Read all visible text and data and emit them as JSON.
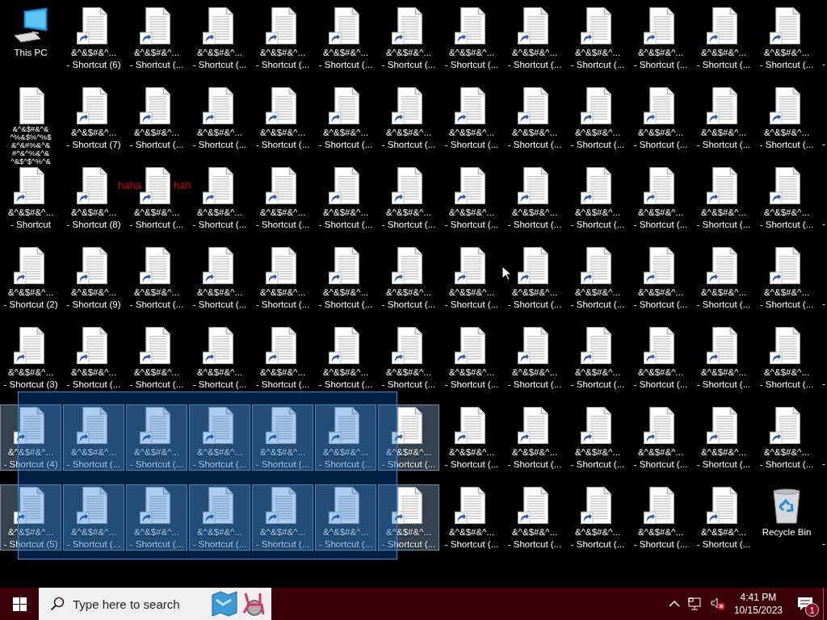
{
  "desktop": {
    "rows": [
      [
        {
          "kind": "pc",
          "label": [
            "This PC"
          ],
          "selected": false
        },
        {
          "kind": "shortcut",
          "label": [
            "&^&$#&^...",
            "- Shortcut (6)"
          ],
          "selected": false
        },
        {
          "kind": "shortcut",
          "label": [
            "&^&$#&^...",
            "- Shortcut (..."
          ],
          "selected": false
        },
        {
          "kind": "shortcut",
          "label": [
            "&^&$#&^...",
            "- Shortcut (..."
          ],
          "selected": false
        },
        {
          "kind": "shortcut",
          "label": [
            "&^&$#&^...",
            "- Shortcut (..."
          ],
          "selected": false
        },
        {
          "kind": "shortcut",
          "label": [
            "&^&$#&^...",
            "- Shortcut (..."
          ],
          "selected": false
        },
        {
          "kind": "shortcut",
          "label": [
            "&^&$#&^...",
            "- Shortcut (..."
          ],
          "selected": false
        },
        {
          "kind": "shortcut",
          "label": [
            "&^&$#&^...",
            "- Shortcut (..."
          ],
          "selected": false
        },
        {
          "kind": "shortcut",
          "label": [
            "&^&$#&^...",
            "- Shortcut (..."
          ],
          "selected": false
        },
        {
          "kind": "shortcut",
          "label": [
            "&^&$#&^...",
            "- Shortcut (..."
          ],
          "selected": false
        },
        {
          "kind": "shortcut",
          "label": [
            "&^&$#&^...",
            "- Shortcut (..."
          ],
          "selected": false
        },
        {
          "kind": "shortcut",
          "label": [
            "&^&$#&^...",
            "- Shortcut (..."
          ],
          "selected": false
        },
        {
          "kind": "shortcut",
          "label": [
            "&^&$#&^...",
            "- Shortcut (..."
          ],
          "selected": false
        },
        {
          "kind": "edge",
          "label": [
            "-"
          ],
          "selected": false
        }
      ],
      [
        {
          "kind": "file",
          "label": [
            "&^&$#&^&",
            "^%&$%^%$",
            "&^&#%&^&",
            "#^&^%&^&",
            "^&$^$^%^&"
          ],
          "selected": false
        },
        {
          "kind": "shortcut",
          "label": [
            "&^&$#&^...",
            "- Shortcut (7)"
          ],
          "selected": false
        },
        {
          "kind": "shortcut",
          "label": [
            "&^&$#&^...",
            "- Shortcut (..."
          ],
          "selected": false
        },
        {
          "kind": "shortcut",
          "label": [
            "&^&$#&^...",
            "- Shortcut (..."
          ],
          "selected": false
        },
        {
          "kind": "shortcut",
          "label": [
            "&^&$#&^...",
            "- Shortcut (..."
          ],
          "selected": false
        },
        {
          "kind": "shortcut",
          "label": [
            "&^&$#&^...",
            "- Shortcut (..."
          ],
          "selected": false
        },
        {
          "kind": "shortcut",
          "label": [
            "&^&$#&^...",
            "- Shortcut (..."
          ],
          "selected": false
        },
        {
          "kind": "shortcut",
          "label": [
            "&^&$#&^...",
            "- Shortcut (..."
          ],
          "selected": false
        },
        {
          "kind": "shortcut",
          "label": [
            "&^&$#&^...",
            "- Shortcut (..."
          ],
          "selected": false
        },
        {
          "kind": "shortcut",
          "label": [
            "&^&$#&^...",
            "- Shortcut (..."
          ],
          "selected": false
        },
        {
          "kind": "shortcut",
          "label": [
            "&^&$#&^...",
            "- Shortcut (..."
          ],
          "selected": false
        },
        {
          "kind": "shortcut",
          "label": [
            "&^&$#&^...",
            "- Shortcut (..."
          ],
          "selected": false
        },
        {
          "kind": "shortcut",
          "label": [
            "&^&$#&^...",
            "- Shortcut (..."
          ],
          "selected": false
        },
        {
          "kind": "edge",
          "label": [
            "-"
          ],
          "selected": false
        }
      ],
      [
        {
          "kind": "shortcut",
          "label": [
            "&^&$#&^...",
            "- Shortcut"
          ],
          "selected": false
        },
        {
          "kind": "shortcut",
          "label": [
            "&^&$#&^...",
            "- Shortcut (8)"
          ],
          "selected": false
        },
        {
          "kind": "shortcut",
          "label": [
            "&^&$#&^...",
            "- Shortcut (..."
          ],
          "selected": false
        },
        {
          "kind": "shortcut",
          "label": [
            "&^&$#&^...",
            "- Shortcut (..."
          ],
          "selected": false
        },
        {
          "kind": "shortcut",
          "label": [
            "&^&$#&^...",
            "- Shortcut (..."
          ],
          "selected": false
        },
        {
          "kind": "shortcut",
          "label": [
            "&^&$#&^...",
            "- Shortcut (..."
          ],
          "selected": false
        },
        {
          "kind": "shortcut",
          "label": [
            "&^&$#&^...",
            "- Shortcut (..."
          ],
          "selected": false
        },
        {
          "kind": "shortcut",
          "label": [
            "&^&$#&^...",
            "- Shortcut (..."
          ],
          "selected": false
        },
        {
          "kind": "shortcut",
          "label": [
            "&^&$#&^...",
            "- Shortcut (..."
          ],
          "selected": false
        },
        {
          "kind": "shortcut",
          "label": [
            "&^&$#&^...",
            "- Shortcut (..."
          ],
          "selected": false
        },
        {
          "kind": "shortcut",
          "label": [
            "&^&$#&^...",
            "- Shortcut (..."
          ],
          "selected": false
        },
        {
          "kind": "shortcut",
          "label": [
            "&^&$#&^...",
            "- Shortcut (..."
          ],
          "selected": false
        },
        {
          "kind": "shortcut",
          "label": [
            "&^&$#&^...",
            "- Shortcut (..."
          ],
          "selected": false
        },
        {
          "kind": "edge",
          "label": [
            "-"
          ],
          "selected": false
        }
      ],
      [
        {
          "kind": "shortcut",
          "label": [
            "&^&$#&^...",
            "- Shortcut (2)"
          ],
          "selected": false
        },
        {
          "kind": "shortcut",
          "label": [
            "&^&$#&^...",
            "- Shortcut (9)"
          ],
          "selected": false
        },
        {
          "kind": "shortcut",
          "label": [
            "&^&$#&^...",
            "- Shortcut (..."
          ],
          "selected": false
        },
        {
          "kind": "shortcut",
          "label": [
            "&^&$#&^...",
            "- Shortcut (..."
          ],
          "selected": false
        },
        {
          "kind": "shortcut",
          "label": [
            "&^&$#&^...",
            "- Shortcut (..."
          ],
          "selected": false
        },
        {
          "kind": "shortcut",
          "label": [
            "&^&$#&^...",
            "- Shortcut (..."
          ],
          "selected": false
        },
        {
          "kind": "shortcut",
          "label": [
            "&^&$#&^...",
            "- Shortcut (..."
          ],
          "selected": false
        },
        {
          "kind": "shortcut",
          "label": [
            "&^&$#&^...",
            "- Shortcut (..."
          ],
          "selected": false
        },
        {
          "kind": "shortcut",
          "label": [
            "&^&$#&^...",
            "- Shortcut (..."
          ],
          "selected": false
        },
        {
          "kind": "shortcut",
          "label": [
            "&^&$#&^...",
            "- Shortcut (..."
          ],
          "selected": false
        },
        {
          "kind": "shortcut",
          "label": [
            "&^&$#&^...",
            "- Shortcut (..."
          ],
          "selected": false
        },
        {
          "kind": "shortcut",
          "label": [
            "&^&$#&^...",
            "- Shortcut (..."
          ],
          "selected": false
        },
        {
          "kind": "shortcut",
          "label": [
            "&^&$#&^...",
            "- Shortcut (..."
          ],
          "selected": false
        },
        {
          "kind": "edge",
          "label": [
            "-"
          ],
          "selected": false
        }
      ],
      [
        {
          "kind": "shortcut",
          "label": [
            "&^&$#&^...",
            "- Shortcut (3)"
          ],
          "selected": false
        },
        {
          "kind": "shortcut",
          "label": [
            "&^&$#&^...",
            "- Shortcut (..."
          ],
          "selected": false
        },
        {
          "kind": "shortcut",
          "label": [
            "&^&$#&^...",
            "- Shortcut (..."
          ],
          "selected": false
        },
        {
          "kind": "shortcut",
          "label": [
            "&^&$#&^...",
            "- Shortcut (..."
          ],
          "selected": false
        },
        {
          "kind": "shortcut",
          "label": [
            "&^&$#&^...",
            "- Shortcut (..."
          ],
          "selected": false
        },
        {
          "kind": "shortcut",
          "label": [
            "&^&$#&^...",
            "- Shortcut (..."
          ],
          "selected": false
        },
        {
          "kind": "shortcut",
          "label": [
            "&^&$#&^...",
            "- Shortcut (..."
          ],
          "selected": false
        },
        {
          "kind": "shortcut",
          "label": [
            "&^&$#&^...",
            "- Shortcut (..."
          ],
          "selected": false
        },
        {
          "kind": "shortcut",
          "label": [
            "&^&$#&^...",
            "- Shortcut (..."
          ],
          "selected": false
        },
        {
          "kind": "shortcut",
          "label": [
            "&^&$#&^...",
            "- Shortcut (..."
          ],
          "selected": false
        },
        {
          "kind": "shortcut",
          "label": [
            "&^&$#&^...",
            "- Shortcut (..."
          ],
          "selected": false
        },
        {
          "kind": "shortcut",
          "label": [
            "&^&$#&^...",
            "- Shortcut (..."
          ],
          "selected": false
        },
        {
          "kind": "shortcut",
          "label": [
            "&^&$#&^...",
            "- Shortcut (..."
          ],
          "selected": false
        },
        {
          "kind": "edge",
          "label": [
            "-"
          ],
          "selected": false
        }
      ],
      [
        {
          "kind": "shortcut",
          "label": [
            "&^&$#&^...",
            "- Shortcut (4)"
          ],
          "selected": true
        },
        {
          "kind": "shortcut",
          "label": [
            "&^&$#&^...",
            "- Shortcut (..."
          ],
          "selected": true
        },
        {
          "kind": "shortcut",
          "label": [
            "&^&$#&^...",
            "- Shortcut (..."
          ],
          "selected": true
        },
        {
          "kind": "shortcut",
          "label": [
            "&^&$#&^...",
            "- Shortcut (..."
          ],
          "selected": true
        },
        {
          "kind": "shortcut",
          "label": [
            "&^&$#&^...",
            "- Shortcut (..."
          ],
          "selected": true
        },
        {
          "kind": "shortcut",
          "label": [
            "&^&$#&^...",
            "- Shortcut (..."
          ],
          "selected": true
        },
        {
          "kind": "shortcut",
          "label": [
            "&^&$#&^...",
            "- Shortcut (..."
          ],
          "selected": true
        },
        {
          "kind": "shortcut",
          "label": [
            "&^&$#&^...",
            "- Shortcut (..."
          ],
          "selected": false
        },
        {
          "kind": "shortcut",
          "label": [
            "&^&$#&^...",
            "- Shortcut (..."
          ],
          "selected": false
        },
        {
          "kind": "shortcut",
          "label": [
            "&^&$#&^...",
            "- Shortcut (..."
          ],
          "selected": false
        },
        {
          "kind": "shortcut",
          "label": [
            "&^&$#&^...",
            "- Shortcut (..."
          ],
          "selected": false
        },
        {
          "kind": "shortcut",
          "label": [
            "&^&$#&^...",
            "- Shortcut (..."
          ],
          "selected": false
        },
        {
          "kind": "shortcut",
          "label": [
            "&^&$#&^...",
            "- Shortcut (..."
          ],
          "selected": false
        },
        {
          "kind": "edge",
          "label": [
            "-"
          ],
          "selected": false
        }
      ],
      [
        {
          "kind": "shortcut",
          "label": [
            "&^&$#&^...",
            "- Shortcut (5)"
          ],
          "selected": true
        },
        {
          "kind": "shortcut",
          "label": [
            "&^&$#&^...",
            "- Shortcut (..."
          ],
          "selected": true
        },
        {
          "kind": "shortcut",
          "label": [
            "&^&$#&^...",
            "- Shortcut (..."
          ],
          "selected": true
        },
        {
          "kind": "shortcut",
          "label": [
            "&^&$#&^...",
            "- Shortcut (..."
          ],
          "selected": true
        },
        {
          "kind": "shortcut",
          "label": [
            "&^&$#&^...",
            "- Shortcut (..."
          ],
          "selected": true
        },
        {
          "kind": "shortcut",
          "label": [
            "&^&$#&^...",
            "- Shortcut (..."
          ],
          "selected": true
        },
        {
          "kind": "shortcut",
          "label": [
            "&^&$#&^...",
            "- Shortcut (..."
          ],
          "selected": true
        },
        {
          "kind": "shortcut",
          "label": [
            "&^&$#&^...",
            "- Shortcut (..."
          ],
          "selected": false
        },
        {
          "kind": "shortcut",
          "label": [
            "&^&$#&^...",
            "- Shortcut (..."
          ],
          "selected": false
        },
        {
          "kind": "shortcut",
          "label": [
            "&^&$#&^...",
            "- Shortcut (..."
          ],
          "selected": false
        },
        {
          "kind": "shortcut",
          "label": [
            "&^&$#&^...",
            "- Shortcut (..."
          ],
          "selected": false
        },
        {
          "kind": "shortcut",
          "label": [
            "&^&$#&^...",
            "- Shortcut (..."
          ],
          "selected": false
        },
        {
          "kind": "recycle",
          "label": [
            "Recycle Bin"
          ],
          "selected": false
        },
        {
          "kind": "edge",
          "label": [
            "-"
          ],
          "selected": false
        }
      ]
    ],
    "overlay_text": [
      "haha",
      "hah"
    ]
  },
  "taskbar": {
    "search": {
      "placeholder": "Type here to search"
    },
    "tray": {
      "volume_muted": true,
      "time": "4:41 PM",
      "date": "10/15/2023",
      "notification_count": "1"
    }
  }
}
